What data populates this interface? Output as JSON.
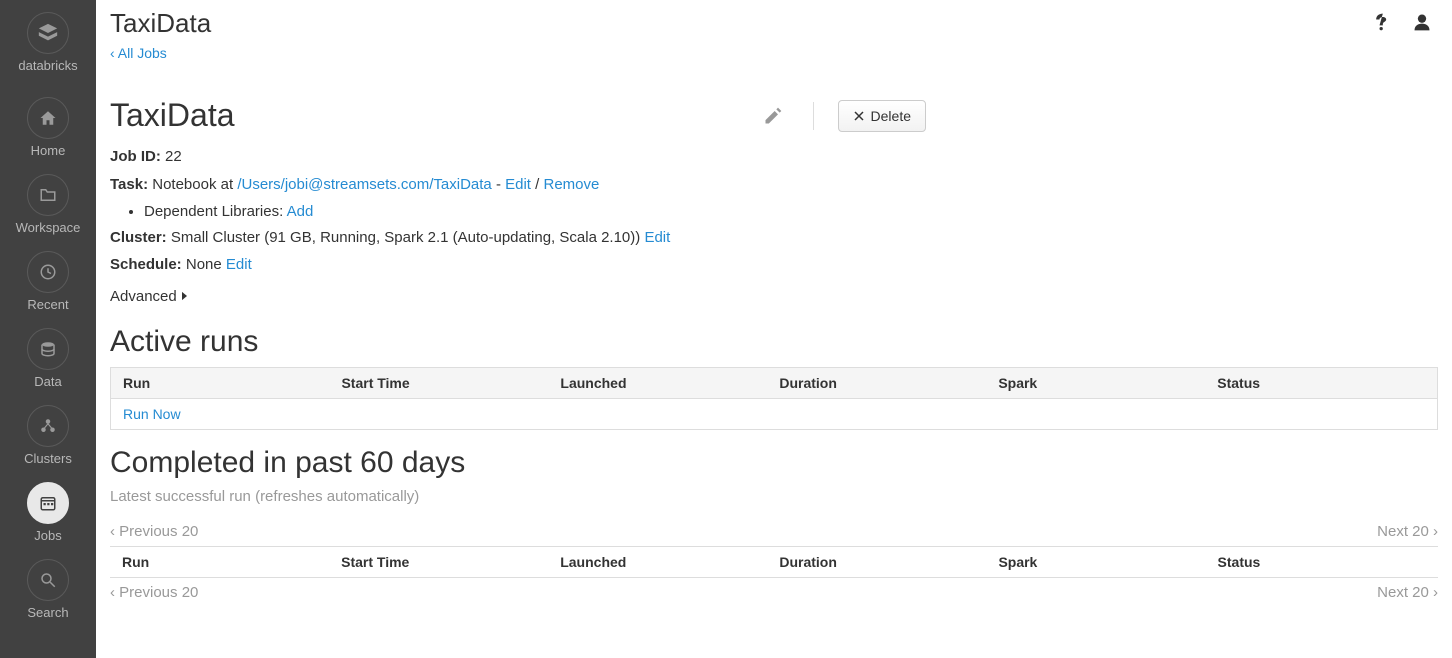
{
  "sidebar": {
    "brand": "databricks",
    "items": [
      {
        "key": "home",
        "label": "Home"
      },
      {
        "key": "workspace",
        "label": "Workspace"
      },
      {
        "key": "recent",
        "label": "Recent"
      },
      {
        "key": "data",
        "label": "Data"
      },
      {
        "key": "clusters",
        "label": "Clusters"
      },
      {
        "key": "jobs",
        "label": "Jobs",
        "active": true
      },
      {
        "key": "search",
        "label": "Search"
      }
    ]
  },
  "breadcrumb": {
    "title": "TaxiData",
    "all_jobs": "‹ All Jobs"
  },
  "header": {
    "job_title": "TaxiData",
    "delete_label": "Delete"
  },
  "meta": {
    "job_id_label": "Job ID:",
    "job_id_value": "22",
    "task_label": "Task:",
    "task_prefix": "Notebook at ",
    "task_path": "/Users/jobi@streamsets.com/TaxiData",
    "task_sep": " - ",
    "task_edit": "Edit",
    "task_slash": " / ",
    "task_remove": "Remove",
    "dep_lib_label": "Dependent Libraries: ",
    "dep_lib_add": "Add",
    "cluster_label": "Cluster:",
    "cluster_value": "Small Cluster (91 GB, Running, Spark 2.1 (Auto-updating, Scala 2.10))",
    "cluster_edit": "Edit",
    "schedule_label": "Schedule:",
    "schedule_value": "None",
    "schedule_edit": "Edit",
    "advanced": "Advanced"
  },
  "active_runs": {
    "title": "Active runs",
    "cols": {
      "run": "Run",
      "start": "Start Time",
      "launched": "Launched",
      "duration": "Duration",
      "spark": "Spark",
      "status": "Status"
    },
    "run_now": "Run Now"
  },
  "completed": {
    "title": "Completed in past 60 days",
    "subtext": "Latest successful run (refreshes automatically)",
    "prev": "‹ Previous 20",
    "next": "Next 20 ›",
    "cols": {
      "run": "Run",
      "start": "Start Time",
      "launched": "Launched",
      "duration": "Duration",
      "spark": "Spark",
      "status": "Status"
    }
  }
}
